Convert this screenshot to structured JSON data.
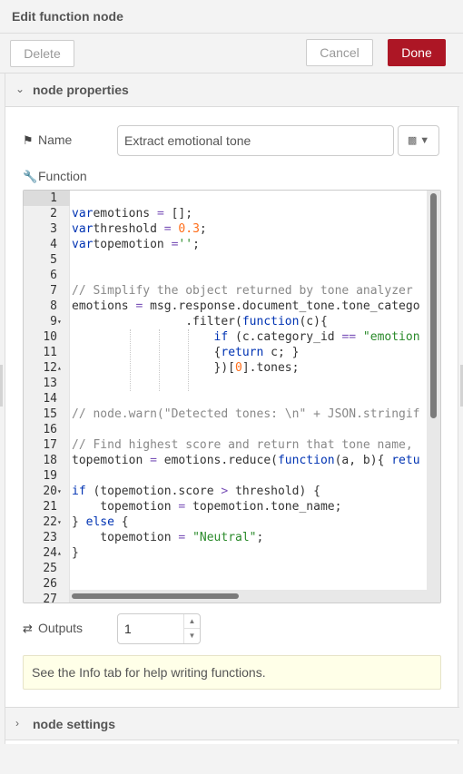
{
  "dialog": {
    "title": "Edit function node"
  },
  "toolbar": {
    "delete_label": "Delete",
    "cancel_label": "Cancel",
    "done_label": "Done",
    "done_color": "#ad1625"
  },
  "sections": {
    "properties_label": "node properties",
    "settings_label": "node settings"
  },
  "name_field": {
    "label": "Name",
    "value": "Extract emotional tone",
    "icon": "tag-icon"
  },
  "function_field": {
    "label": "Function",
    "icon": "wrench-icon"
  },
  "code_lines": [
    {
      "n": "1",
      "fold": "",
      "segs": []
    },
    {
      "n": "2",
      "fold": "",
      "segs": [
        [
          "kw",
          "var"
        ],
        [
          "",
          "emotions "
        ],
        [
          "op",
          "="
        ],
        [
          "",
          " [];"
        ]
      ]
    },
    {
      "n": "3",
      "fold": "",
      "segs": [
        [
          "kw",
          "var"
        ],
        [
          "",
          "threshold "
        ],
        [
          "op",
          "="
        ],
        [
          "",
          " "
        ],
        [
          "num",
          "0.3"
        ],
        [
          "",
          ";"
        ]
      ]
    },
    {
      "n": "4",
      "fold": "",
      "segs": [
        [
          "kw",
          "var"
        ],
        [
          "",
          "topemotion "
        ],
        [
          "op",
          "="
        ],
        [
          "str",
          "''"
        ],
        [
          "",
          ";"
        ]
      ]
    },
    {
      "n": "5",
      "fold": "",
      "segs": []
    },
    {
      "n": "6",
      "fold": "",
      "segs": []
    },
    {
      "n": "7",
      "fold": "",
      "segs": [
        [
          "cm",
          "// Simplify the object returned by tone analyzer"
        ]
      ]
    },
    {
      "n": "8",
      "fold": "",
      "segs": [
        [
          "",
          "emotions "
        ],
        [
          "op",
          "="
        ],
        [
          "",
          " msg.response.document_tone.tone_catego"
        ]
      ]
    },
    {
      "n": "9",
      "fold": "▾",
      "segs": [
        [
          "",
          "                .filter("
        ],
        [
          "kw",
          "function"
        ],
        [
          "",
          "(c){"
        ]
      ]
    },
    {
      "n": "10",
      "fold": "",
      "segs": [
        [
          "",
          "                    "
        ],
        [
          "kw",
          "if"
        ],
        [
          "",
          " (c.category_id "
        ],
        [
          "op",
          "=="
        ],
        [
          "",
          " "
        ],
        [
          "str",
          "\"emotion"
        ]
      ]
    },
    {
      "n": "11",
      "fold": "",
      "segs": [
        [
          "",
          "                    {"
        ],
        [
          "kw",
          "return"
        ],
        [
          "",
          " c; }"
        ]
      ]
    },
    {
      "n": "12",
      "fold": "▴",
      "segs": [
        [
          "",
          "                    })["
        ],
        [
          "num",
          "0"
        ],
        [
          "",
          "].tones;"
        ]
      ]
    },
    {
      "n": "13",
      "fold": "",
      "segs": []
    },
    {
      "n": "14",
      "fold": "",
      "segs": []
    },
    {
      "n": "15",
      "fold": "",
      "segs": [
        [
          "cm",
          "// node.warn(\"Detected tones: \\n\" + JSON.stringif"
        ]
      ]
    },
    {
      "n": "16",
      "fold": "",
      "segs": []
    },
    {
      "n": "17",
      "fold": "",
      "segs": [
        [
          "cm",
          "// Find highest score and return that tone name,"
        ]
      ]
    },
    {
      "n": "18",
      "fold": "",
      "segs": [
        [
          "",
          "topemotion "
        ],
        [
          "op",
          "="
        ],
        [
          "",
          " emotions.reduce("
        ],
        [
          "kw",
          "function"
        ],
        [
          "",
          "(a, b){ "
        ],
        [
          "kw",
          "retu"
        ]
      ]
    },
    {
      "n": "19",
      "fold": "",
      "segs": []
    },
    {
      "n": "20",
      "fold": "▾",
      "segs": [
        [
          "kw",
          "if"
        ],
        [
          "",
          " (topemotion.score "
        ],
        [
          "op",
          ">"
        ],
        [
          "",
          " threshold) {"
        ]
      ]
    },
    {
      "n": "21",
      "fold": "",
      "segs": [
        [
          "",
          "    topemotion "
        ],
        [
          "op",
          "="
        ],
        [
          "",
          " topemotion.tone_name;"
        ]
      ]
    },
    {
      "n": "22",
      "fold": "▾",
      "segs": [
        [
          "",
          "} "
        ],
        [
          "kw",
          "else"
        ],
        [
          "",
          " {"
        ]
      ]
    },
    {
      "n": "23",
      "fold": "",
      "segs": [
        [
          "",
          "    topemotion "
        ],
        [
          "op",
          "="
        ],
        [
          "",
          " "
        ],
        [
          "str",
          "\"Neutral\""
        ],
        [
          "",
          ";"
        ]
      ]
    },
    {
      "n": "24",
      "fold": "▴",
      "segs": [
        [
          "",
          "}"
        ]
      ]
    },
    {
      "n": "25",
      "fold": "",
      "segs": []
    },
    {
      "n": "26",
      "fold": "",
      "segs": []
    },
    {
      "n": "27",
      "fold": "",
      "segs": []
    }
  ],
  "outputs_field": {
    "label": "Outputs",
    "value": "1",
    "icon": "shuffle-icon"
  },
  "tip": {
    "text": "See the Info tab for help writing functions."
  }
}
